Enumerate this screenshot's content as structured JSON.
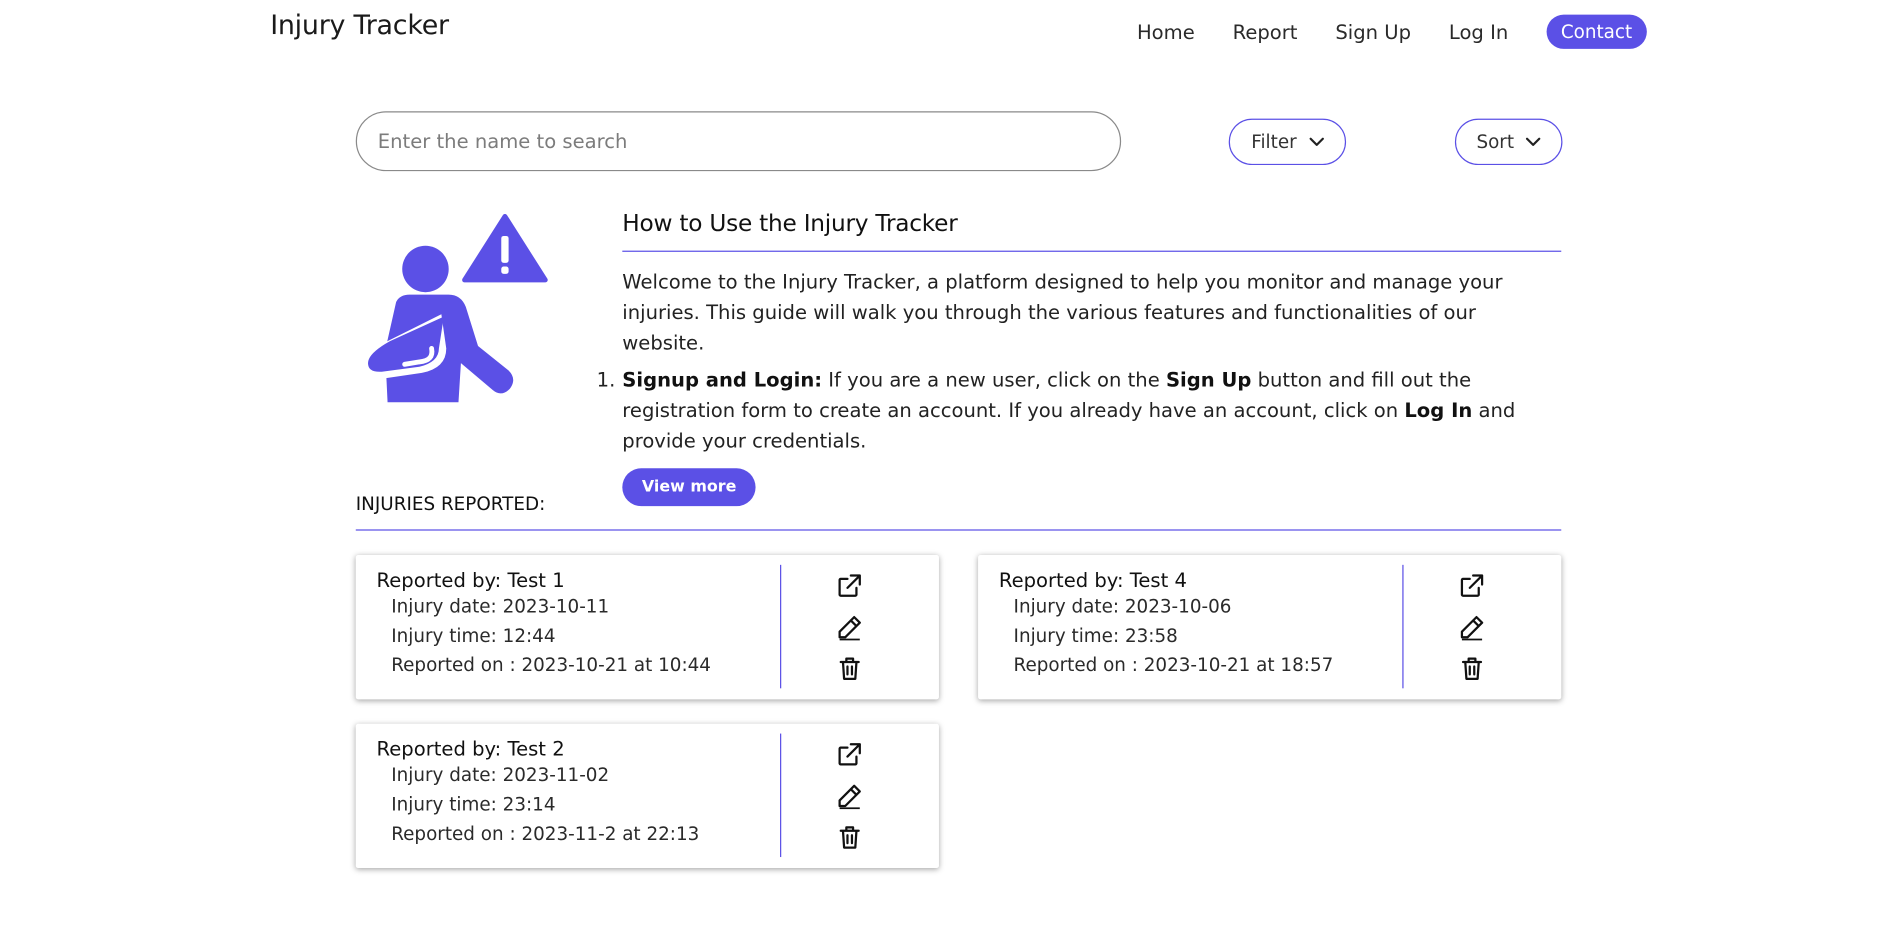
{
  "header": {
    "brand": "Injury Tracker",
    "nav": [
      {
        "label": "Home"
      },
      {
        "label": "Report"
      },
      {
        "label": "Sign Up"
      },
      {
        "label": "Log In"
      },
      {
        "label": "Contact"
      }
    ]
  },
  "search": {
    "placeholder": "Enter the name to search",
    "value": ""
  },
  "controls": {
    "filter_label": "Filter",
    "sort_label": "Sort"
  },
  "guide": {
    "title": "How to Use the Injury Tracker",
    "intro": "Welcome to the Injury Tracker, a platform designed to help you monitor and manage your injuries. This guide will walk you through the various features and functionalities of our website.",
    "step_number": "1.",
    "step_title": "Signup and Login:",
    "step_text_1": " If you are a new user, click on the ",
    "step_bold_1": "Sign Up",
    "step_text_2": " button and fill out the registration form to create an account. If you already have an account, click on ",
    "step_bold_2": "Log In",
    "step_text_3": " and provide your credentials.",
    "view_more_label": "View more"
  },
  "injuries": {
    "title": "INJURIES REPORTED:",
    "items": [
      {
        "reported_by": "Reported by: Test 1",
        "injury_date": "Injury date: 2023-10-11",
        "injury_time": "Injury time: 12:44",
        "reported_on": "Reported on : 2023-10-21 at 10:44"
      },
      {
        "reported_by": "Reported by: Test 4",
        "injury_date": "Injury date: 2023-10-06",
        "injury_time": "Injury time: 23:58",
        "reported_on": "Reported on : 2023-10-21 at 18:57"
      },
      {
        "reported_by": "Reported by: Test 2",
        "injury_date": "Injury date: 2023-11-02",
        "injury_time": "Injury time: 23:14",
        "reported_on": "Reported on : 2023-11-2 at 22:13"
      }
    ]
  },
  "icons": {
    "open": "external-link-icon",
    "edit": "pencil-icon",
    "delete": "trash-icon",
    "hero": "injured-person-warning-icon",
    "chevron": "chevron-down-icon"
  },
  "colors": {
    "accent": "#5b50e6"
  }
}
